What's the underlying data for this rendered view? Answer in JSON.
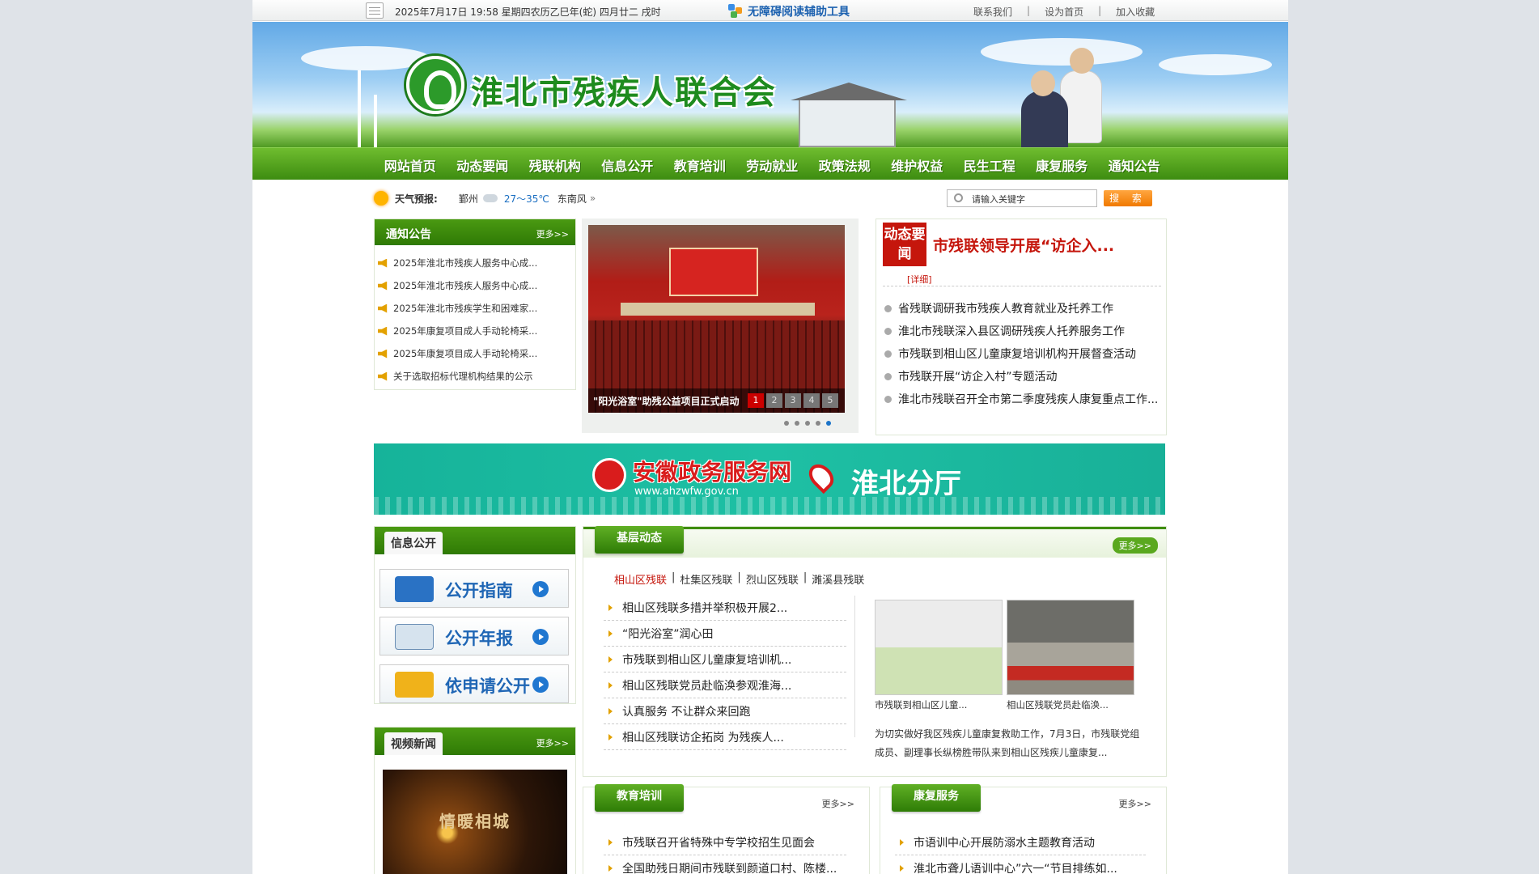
{
  "topbar": {
    "date": "2025年7月17日 19:58 星期四农历乙巳年(蛇) 四月廿二 戌时",
    "accessibility": "无障碍阅读辅助工具",
    "links": [
      "联系我们",
      "设为首页",
      "加入收藏"
    ]
  },
  "header": {
    "site_title": "淮北市残疾人联合会"
  },
  "nav": [
    "网站首页",
    "动态要闻",
    "残联机构",
    "信息公开",
    "教育培训",
    "劳动就业",
    "政策法规",
    "维护权益",
    "民生工程",
    "康复服务",
    "通知公告"
  ],
  "weather": {
    "label": "天气预报:",
    "city": "鄞州",
    "temp": "27～35℃",
    "wind": "东南风"
  },
  "search": {
    "placeholder": "请输入关键字",
    "button": "搜 索"
  },
  "notice": {
    "title": "通知公告",
    "more": "更多>>",
    "items": [
      "2025年淮北市残疾人服务中心成...",
      "2025年淮北市残疾人服务中心成...",
      "2025年淮北市残疾学生和困难家...",
      "2025年康复项目成人手动轮椅采...",
      "2025年康复项目成人手动轮椅采...",
      "关于选取招标代理机构结果的公示"
    ]
  },
  "slider": {
    "caption": "\"阳光浴室\"助残公益项目正式启动",
    "pages": [
      "1",
      "2",
      "3",
      "4",
      "5"
    ]
  },
  "dynamic": {
    "tag": "动态要闻",
    "headline": "市残联领导开展“访企入...",
    "detail": "[详细]",
    "items": [
      "省残联调研我市残疾人教育就业及托养工作",
      "淮北市残联深入县区调研残疾人托养服务工作",
      "市残联到相山区儿童康复培训机构开展督查活动",
      "市残联开展“访企入村”专题活动",
      "淮北市残联召开全市第二季度残疾人康复重点工作..."
    ]
  },
  "wide_banner": {
    "title": "安徽政务服务网",
    "url": "www.ahzwfw.gov.cn",
    "branch": "淮北分厅"
  },
  "info_public": {
    "title": "信息公开",
    "buttons": [
      "公开指南",
      "公开年报",
      "依申请公开"
    ]
  },
  "video_news": {
    "title": "视频新闻",
    "more": "更多>>",
    "video_title": "情暖相城"
  },
  "grassroots": {
    "title": "基层动态",
    "more": "更多>>",
    "tabs": [
      "相山区残联",
      "杜集区残联",
      "烈山区残联",
      "濉溪县残联"
    ],
    "items": [
      "相山区残联多措并举积极开展2...",
      "“阳光浴室”润心田",
      "市残联到相山区儿童康复培训机...",
      "相山区残联党员赴临涣参观淮海...",
      "认真服务 不让群众来回跑",
      "相山区残联访企拓岗 为残疾人..."
    ],
    "photos": [
      "市残联到相山区儿童...",
      "相山区残联党员赴临涣..."
    ],
    "summary": "为切实做好我区残疾儿童康复救助工作，7月3日，市残联党组成员、副理事长纵榜胜带队来到相山区残疾儿童康复..."
  },
  "education": {
    "title": "教育培训",
    "more": "更多>>",
    "items": [
      "市残联召开省特殊中专学校招生见面会",
      "全国助残日期间市残联到颜道口村、陈楼..."
    ]
  },
  "rehab": {
    "title": "康复服务",
    "more": "更多>>",
    "items": [
      "市语训中心开展防溺水主题教育活动",
      "淮北市聋儿语训中心”六一“节目排练如..."
    ]
  }
}
